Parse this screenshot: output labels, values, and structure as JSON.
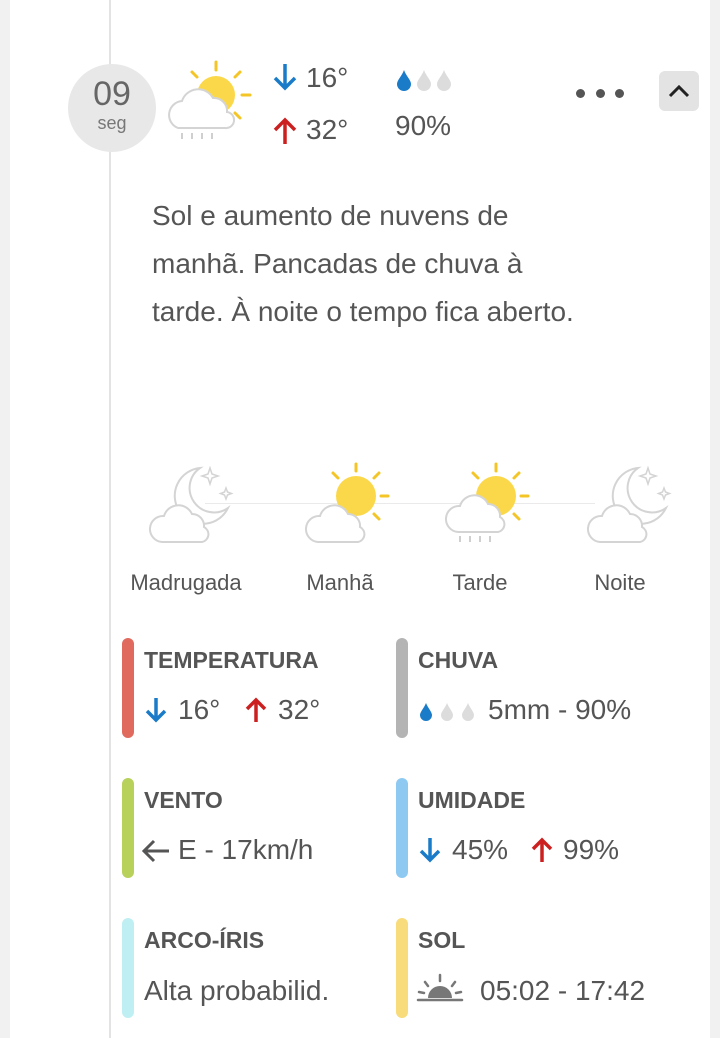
{
  "day": {
    "date_number": "09",
    "weekday": "seg",
    "temp_min": "16°",
    "temp_max": "32°",
    "rain_probability": "90%"
  },
  "description": "Sol e aumento de nuvens de manhã. Pancadas de chuva à tarde. À noite o tempo fica aberto.",
  "periods": [
    {
      "label": "Madrugada",
      "icon": "moon-cloud-icon"
    },
    {
      "label": "Manhã",
      "icon": "sun-cloud-icon"
    },
    {
      "label": "Tarde",
      "icon": "sun-rain-cloud-icon"
    },
    {
      "label": "Noite",
      "icon": "moon-cloud-icon"
    }
  ],
  "stats": {
    "temperatura": {
      "title": "TEMPERATURA",
      "min": "16°",
      "max": "32°",
      "color": "#e06a5e"
    },
    "chuva": {
      "title": "CHUVA",
      "value": "5mm - 90%",
      "color": "#b4b4b4"
    },
    "vento": {
      "title": "VENTO",
      "value": "E - 17km/h",
      "color": "#b7d15b"
    },
    "umidade": {
      "title": "UMIDADE",
      "min": "45%",
      "max": "99%",
      "color": "#8ec9f2"
    },
    "arco_iris": {
      "title": "ARCO-ÍRIS",
      "value": "Alta probabilid.",
      "color": "#bfeff3"
    },
    "sol": {
      "title": "SOL",
      "value": "05:02 - 17:42",
      "color": "#f8db7a"
    }
  },
  "colors": {
    "arrow_down": "#1a7bc9",
    "arrow_up": "#cc2020",
    "drop_filled": "#1a7bc9",
    "drop_empty": "#dcdcdc"
  }
}
